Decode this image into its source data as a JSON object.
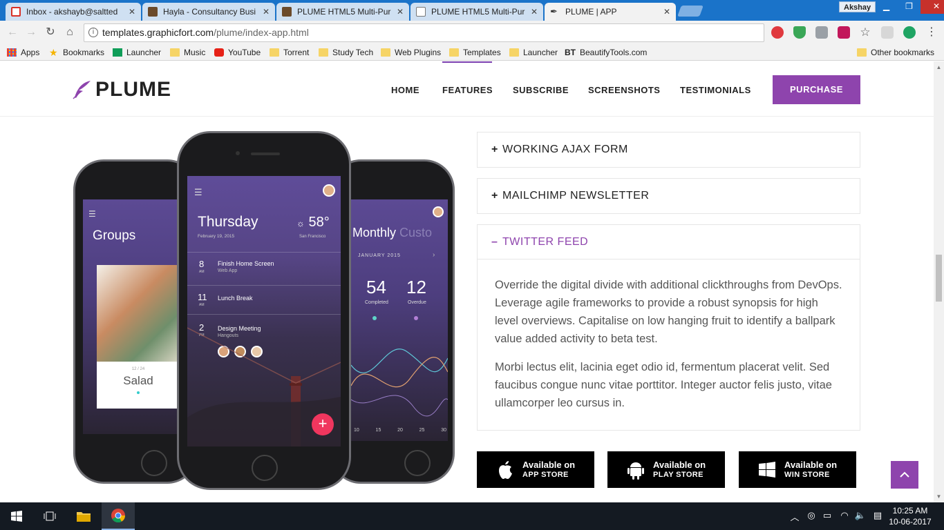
{
  "browser": {
    "tabs": [
      {
        "title": "Inbox - akshayb@saltted",
        "favicon_color": "#d93025"
      },
      {
        "title": "Hayla - Consultancy Busi",
        "favicon_color": "#6b4a2a"
      },
      {
        "title": "PLUME HTML5 Multi-Pur",
        "favicon_color": "#6b4a2a"
      },
      {
        "title": "PLUME HTML5 Multi-Pur",
        "favicon_color": "#ffffff"
      },
      {
        "title": "PLUME | APP",
        "favicon_color": "#333333"
      }
    ],
    "tab_close": "✕",
    "profile_name": "Akshay",
    "url_host": "templates.graphicfort.com",
    "url_path": "/plume/index-app.html",
    "bookmarks": [
      {
        "label": "Apps",
        "icon": "apps-grid-icon"
      },
      {
        "label": "Bookmarks",
        "icon": "star-icon"
      },
      {
        "label": "Launcher",
        "icon": "sheets-icon"
      },
      {
        "label": "Music",
        "icon": "folder-icon"
      },
      {
        "label": "YouTube",
        "icon": "youtube-icon"
      },
      {
        "label": "Torrent",
        "icon": "folder-icon"
      },
      {
        "label": "Study Tech",
        "icon": "folder-icon"
      },
      {
        "label": "Web Plugins",
        "icon": "folder-icon"
      },
      {
        "label": "Templates",
        "icon": "folder-icon"
      },
      {
        "label": "Launcher",
        "icon": "folder-icon"
      },
      {
        "label": "BeautifyTools.com",
        "icon": "bt-icon"
      }
    ],
    "other_bookmarks": "Other bookmarks"
  },
  "site": {
    "logo_text": "PLUME",
    "nav": [
      "HOME",
      "FEATURES",
      "SUBSCRIBE",
      "SCREENSHOTS",
      "TESTIMONIALS"
    ],
    "purchase_label": "PURCHASE",
    "accent_color": "#8e44ad"
  },
  "phones": {
    "left": {
      "title": "Groups",
      "card_counter": "12 / 24",
      "card_title": "Salad"
    },
    "center": {
      "day": "Thursday",
      "date": "February 19, 2015",
      "temperature": "58°",
      "city": "San Francisco",
      "events": [
        {
          "hour": "8",
          "ampm": "AM",
          "title": "Finish Home Screen",
          "subtitle": "Web App"
        },
        {
          "hour": "11",
          "ampm": "AM",
          "title": "Lunch Break",
          "subtitle": ""
        },
        {
          "hour": "2",
          "ampm": "PM",
          "title": "Design Meeting",
          "subtitle": "Hangouts"
        }
      ],
      "fab": "+"
    },
    "right": {
      "title": "Monthly",
      "title_faded": "Custo",
      "month": "JANUARY 2015",
      "stat1_value": "54",
      "stat1_label": "Completed",
      "stat2_value": "12",
      "stat2_label": "Overdue",
      "axis": [
        "10",
        "15",
        "20",
        "25",
        "30"
      ]
    }
  },
  "accordion": [
    {
      "sign": "+",
      "title": "WORKING AJAX FORM"
    },
    {
      "sign": "+",
      "title": "MAILCHIMP NEWSLETTER"
    },
    {
      "sign": "–",
      "title": "TWITTER FEED",
      "paragraphs": [
        "Override the digital divide with additional clickthroughs from DevOps. Leverage agile frameworks to provide a robust synopsis for high level overviews. Capitalise on low hanging fruit to identify a ballpark value added activity to beta test.",
        "Morbi lectus elit, lacinia eget odio id, fermentum placerat velit. Sed faucibus congue nunc vitae porttitor. Integer auctor felis justo, vitae ullamcorper leo cursus in."
      ]
    }
  ],
  "stores": [
    {
      "line1": "Available on",
      "line2": "APP STORE",
      "icon": "apple-icon"
    },
    {
      "line1": "Available on",
      "line2": "PLAY STORE",
      "icon": "android-icon"
    },
    {
      "line1": "Available on",
      "line2": "WIN STORE",
      "icon": "windows-icon"
    }
  ],
  "taskbar": {
    "time": "10:25 AM",
    "date": "10-06-2017"
  }
}
